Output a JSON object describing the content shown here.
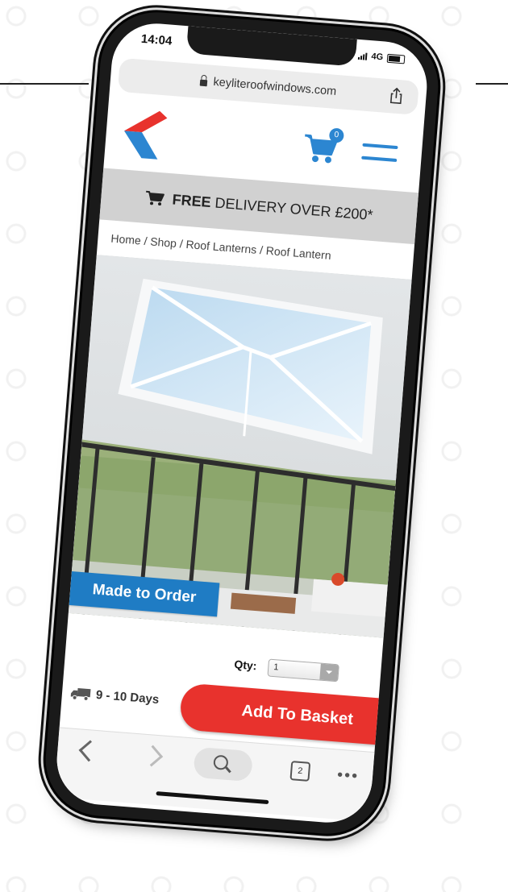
{
  "status_bar": {
    "time": "14:04",
    "network": "4G"
  },
  "browser": {
    "url": "keyliteroofwindows.com",
    "tabs_count": "2"
  },
  "header": {
    "cart_count": "0"
  },
  "banner": {
    "bold": "FREE",
    "text": "DELIVERY OVER £200*"
  },
  "breadcrumb": "Home / Shop / Roof Lanterns / Roof Lantern",
  "product": {
    "badge": "Made to Order"
  },
  "purchase": {
    "qty_label": "Qty:",
    "qty_value": "1",
    "delivery_time": "9 - 10 Days",
    "add_button": "Add To Basket"
  },
  "colors": {
    "brand_blue": "#2c86d1",
    "brand_red": "#e8322d",
    "badge_blue": "#1f7cc4"
  }
}
